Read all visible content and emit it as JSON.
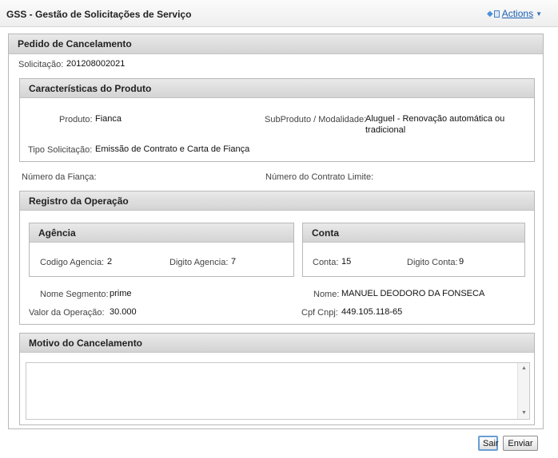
{
  "app": {
    "title": "GSS - Gestão de Solicitações de Serviço",
    "actions_label": "Actions"
  },
  "form": {
    "header": "Pedido de Cancelamento",
    "solicitacao_label": "Solicitação:",
    "solicitacao_value": "201208002021",
    "produto_section": {
      "header": "Características do Produto",
      "produto_label": "Produto:",
      "produto_value": "Fianca",
      "subproduto_label": "SubProduto / Modalidade:",
      "subproduto_value_line1": "Aluguel - Renovação automática ou",
      "subproduto_value_line2": "tradicional",
      "tipo_label": "Tipo Solicitação:",
      "tipo_value": "Emissão de Contrato e Carta de Fiança"
    },
    "numero_fianca_label": "Número da Fiança:",
    "numero_contrato_label": "Número do Contrato Limite:",
    "operacao_section": {
      "header": "Registro da Operação",
      "agencia": {
        "header": "Agência",
        "codigo_label": "Codigo Agencia:",
        "codigo_value": "2",
        "digito_label": "Digito Agencia:",
        "digito_value": "7"
      },
      "conta": {
        "header": "Conta",
        "conta_label": "Conta:",
        "conta_value": "15",
        "digito_label": "Digito Conta:",
        "digito_value": "9"
      },
      "segmento_label": "Nome Segmento:",
      "segmento_value": "prime",
      "nome_label": "Nome:",
      "nome_value": "MANUEL DEODORO DA FONSECA",
      "valor_label": "Valor da Operação:",
      "valor_value": "30.000",
      "cpf_label": "Cpf Cnpj:",
      "cpf_value": "449.105.118-65"
    },
    "motivo_section": {
      "header": "Motivo do Cancelamento",
      "text": ""
    },
    "buttons": {
      "sair": "Sair",
      "enviar": "Enviar"
    }
  },
  "icons": {
    "actions": "document-menu-icon",
    "dropdown": "caret-down-icon",
    "scroll_up": "arrow-up-icon",
    "scroll_down": "arrow-down-icon"
  }
}
